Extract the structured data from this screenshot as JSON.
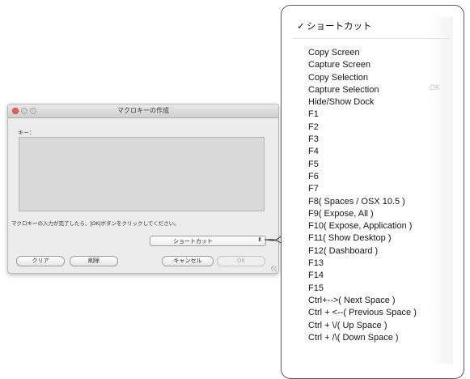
{
  "dialog": {
    "title": "マクロキーの作成",
    "key_label": "キー：",
    "instruction": "マクロキーの入力が完了したら、[OK]ボタンをクリックしてください。",
    "select_value": "ショートカット",
    "select_arrows": "⬍",
    "buttons": {
      "clear": "クリア",
      "delete": "削除",
      "cancel": "キャンセル",
      "ok": "OK"
    }
  },
  "menu": {
    "checkmark": "✓",
    "header": "ショートカット",
    "ghost_ok": "OK",
    "items": [
      "Copy Screen",
      "Capture Screen",
      "Copy Selection",
      "Capture Selection",
      "Hide/Show Dock",
      "F1",
      "F2",
      "F3",
      "F4",
      "F5",
      "F6",
      "F7",
      "F8( Spaces / OSX 10.5 )",
      "F9( Expose, All )",
      "F10( Expose, Application )",
      "F11( Show Desktop )",
      "F12( Dashboard )",
      "F13",
      "F14",
      "F15",
      "Ctrl+-->( Next Space )",
      "Ctrl + <--( Previous Space )",
      "Ctrl + \\/( Up Space )",
      "Ctrl + /\\( Down Space )"
    ]
  },
  "colors": {
    "close_button": "#f25a55",
    "dialog_bg": "#ececec",
    "key_area": "#d9d9d9"
  }
}
